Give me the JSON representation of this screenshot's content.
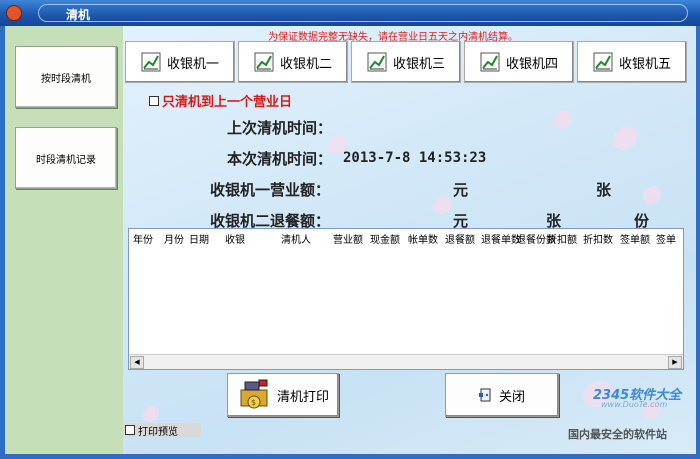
{
  "window": {
    "title": "清机"
  },
  "sidebar": {
    "items": [
      {
        "label": "按时段清机"
      },
      {
        "label": "时段清机记录"
      }
    ]
  },
  "notice": "为保证数据完整无缺失，请在营业日五天之内清机结算。",
  "tabs": [
    {
      "label": "收银机一"
    },
    {
      "label": "收银机二"
    },
    {
      "label": "收银机三"
    },
    {
      "label": "收银机四"
    },
    {
      "label": "收银机五"
    }
  ],
  "checkbox": {
    "label": "只清机到上一个营业日",
    "checked": false
  },
  "info": {
    "last_clear_label": "上次清机时间：",
    "this_clear_label": "本次清机时间：",
    "this_clear_value": "2013-7-8  14:53:23",
    "sales_label": "收银机一营业额：",
    "sales_unit1": "元",
    "sales_unit2": "张",
    "refund_label": "收银机二退餐额：",
    "refund_unit1": "元",
    "refund_unit2": "张",
    "refund_unit3": "份"
  },
  "table": {
    "columns": [
      "年份",
      "月份",
      "日期",
      "收银",
      "清机人",
      "营业额",
      "现金额",
      "帐单数",
      "退餐额",
      "退餐单数",
      "退餐份数",
      "折扣额",
      "折扣数",
      "签单额",
      "签单"
    ]
  },
  "buttons": {
    "print": "清机打印",
    "close": "关闭"
  },
  "print_preview": {
    "label": "打印预览"
  },
  "watermark": {
    "brand": "2345软件大全",
    "url": "www.DuoTe.com",
    "tagline": "国内最安全的软件站"
  },
  "colors": {
    "title_bar": "#1b57ae",
    "sidebar": "#c6dfb8",
    "notice": "#e02020"
  }
}
